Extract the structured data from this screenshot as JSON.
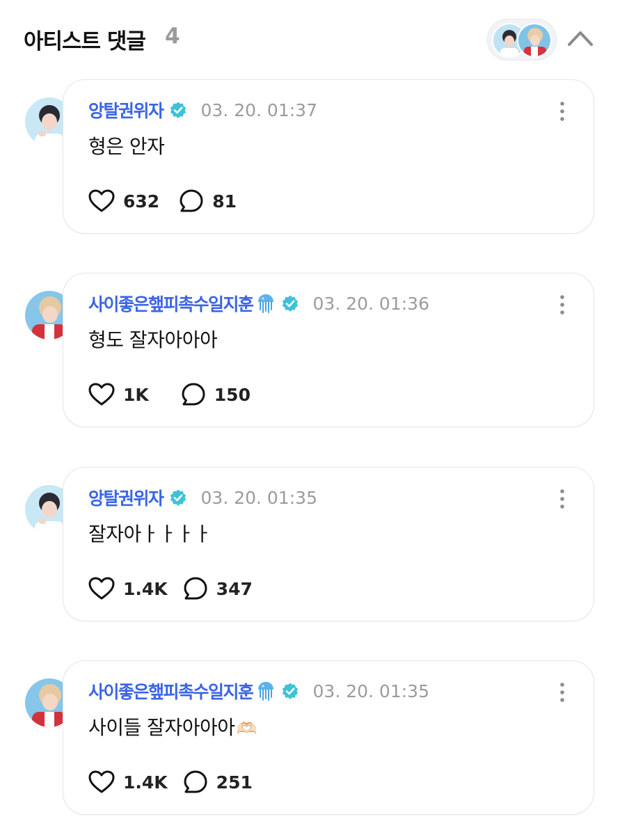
{
  "header": {
    "title": "아티스트 댓글",
    "count": "4"
  },
  "comments": [
    {
      "author": "앙탈권위자",
      "time": "03. 20. 01:37",
      "text": "형은 안자",
      "emoji": "",
      "likes": "632",
      "replies": "81"
    },
    {
      "author": "사이좋은햎피촉수일지훈",
      "time": "03. 20. 01:36",
      "text": "형도 잘자아아아",
      "emoji": "",
      "likes": "1K",
      "replies": "150"
    },
    {
      "author": "앙탈권위자",
      "time": "03. 20. 01:35",
      "text": "잘자아ㅏㅏㅏㅏ",
      "emoji": "",
      "likes": "1.4K",
      "replies": "347"
    },
    {
      "author": "사이좋은햎피촉수일지훈",
      "time": "03. 20. 01:35",
      "text": "사이들 잘자아아아",
      "emoji": "🫶🏻",
      "likes": "1.4K",
      "replies": "251"
    }
  ],
  "icons": {
    "verified": "verified-badge-icon",
    "jellyfish": "jellyfish-emoji-icon",
    "like": "heart-icon",
    "reply": "speech-bubble-icon",
    "more": "more-vertical-icon",
    "collapse": "chevron-up-icon"
  },
  "colors": {
    "author_name": "#3b64e6",
    "verified_badge": "#3ec2d8",
    "timestamp": "#9b9b9b",
    "count_gray": "#9a9a9a",
    "card_border": "#e5e5e5"
  }
}
